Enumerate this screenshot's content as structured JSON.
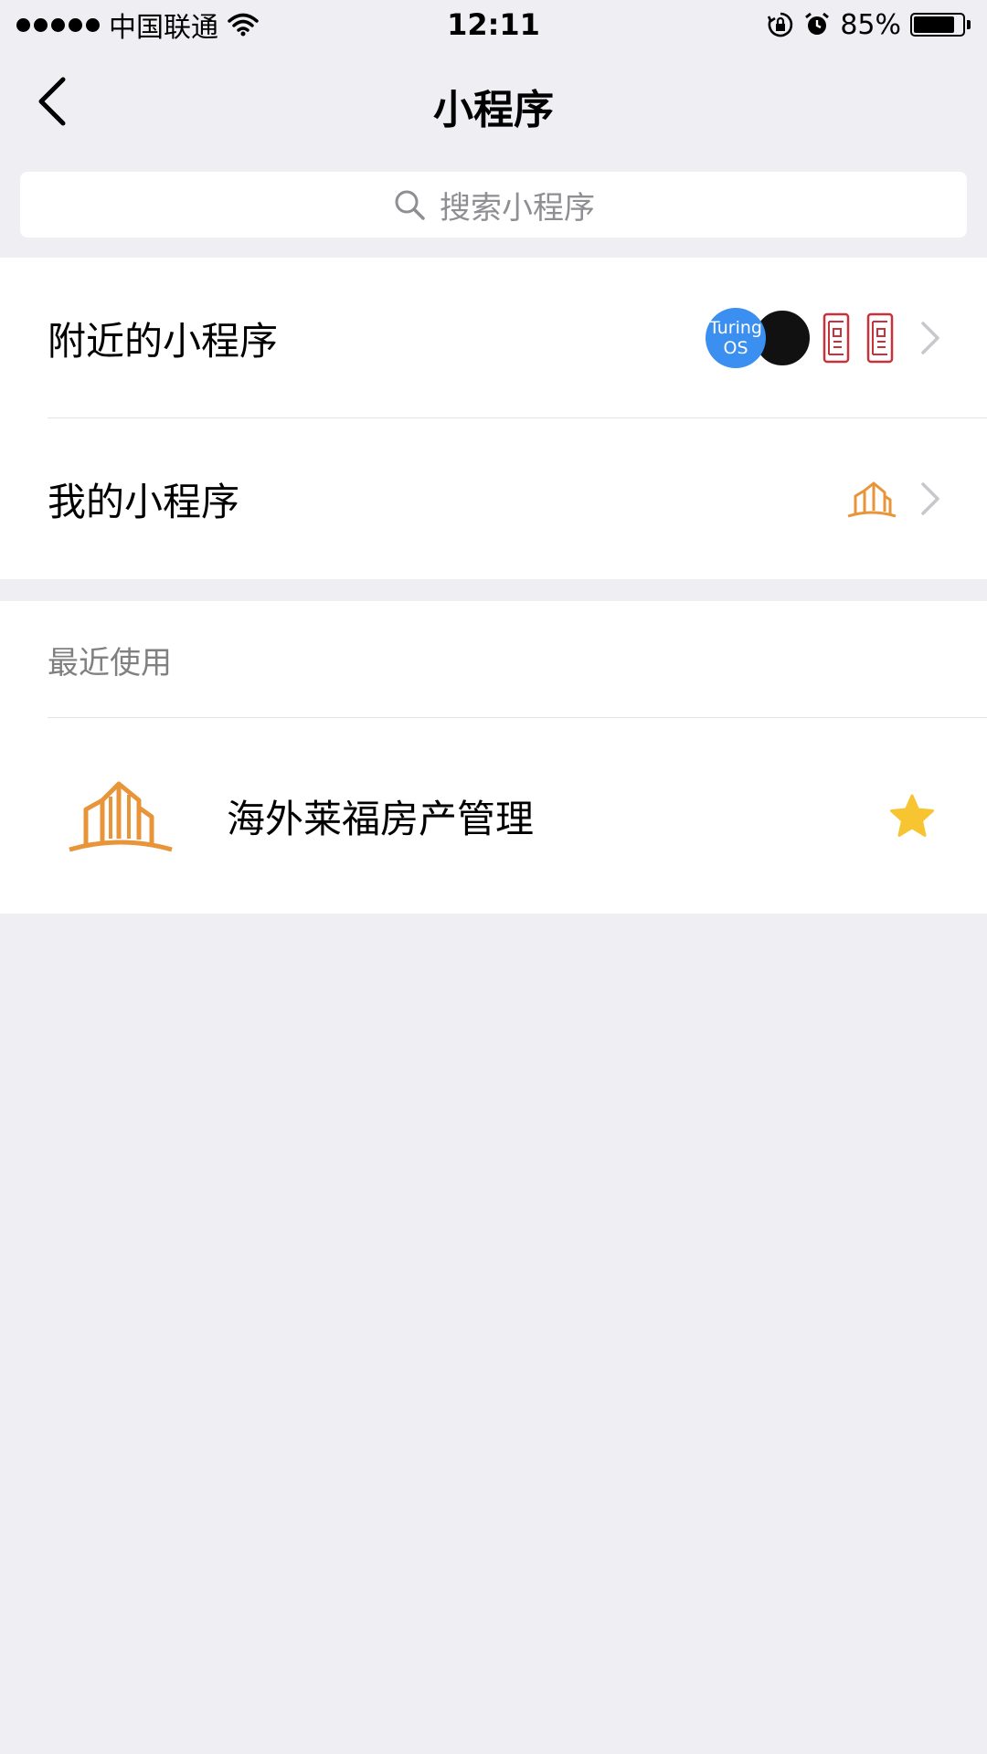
{
  "status_bar": {
    "carrier": "中国联通",
    "time": "12:11",
    "battery_percent_text": "85%",
    "battery_level": 0.85,
    "icons": [
      "signal-dots-icon",
      "wifi-icon",
      "rotation-lock-icon",
      "alarm-icon",
      "battery-icon"
    ]
  },
  "nav": {
    "title": "小程序",
    "back_icon": "chevron-left-icon"
  },
  "search": {
    "placeholder": "搜索小程序",
    "icon": "search-icon"
  },
  "rows": [
    {
      "label": "附近的小程序",
      "icons": [
        "turing-os-icon",
        "dark-circle-app-icon",
        "red-seal-icon",
        "red-seal-icon"
      ]
    },
    {
      "label": "我的小程序",
      "icons": [
        "building-outline-icon"
      ]
    }
  ],
  "nearby_turing_icon_text": [
    "Turing",
    "OS"
  ],
  "recent": {
    "header": "最近使用",
    "items": [
      {
        "name": "海外莱福房产管理",
        "icon": "building-logo-icon",
        "starred": true
      }
    ]
  },
  "colors": {
    "background": "#efeef3",
    "accent_orange": "#e8953a",
    "star_yellow": "#f7c531",
    "turing_blue": "#3a8ff0",
    "seal_red": "#c8323a"
  }
}
